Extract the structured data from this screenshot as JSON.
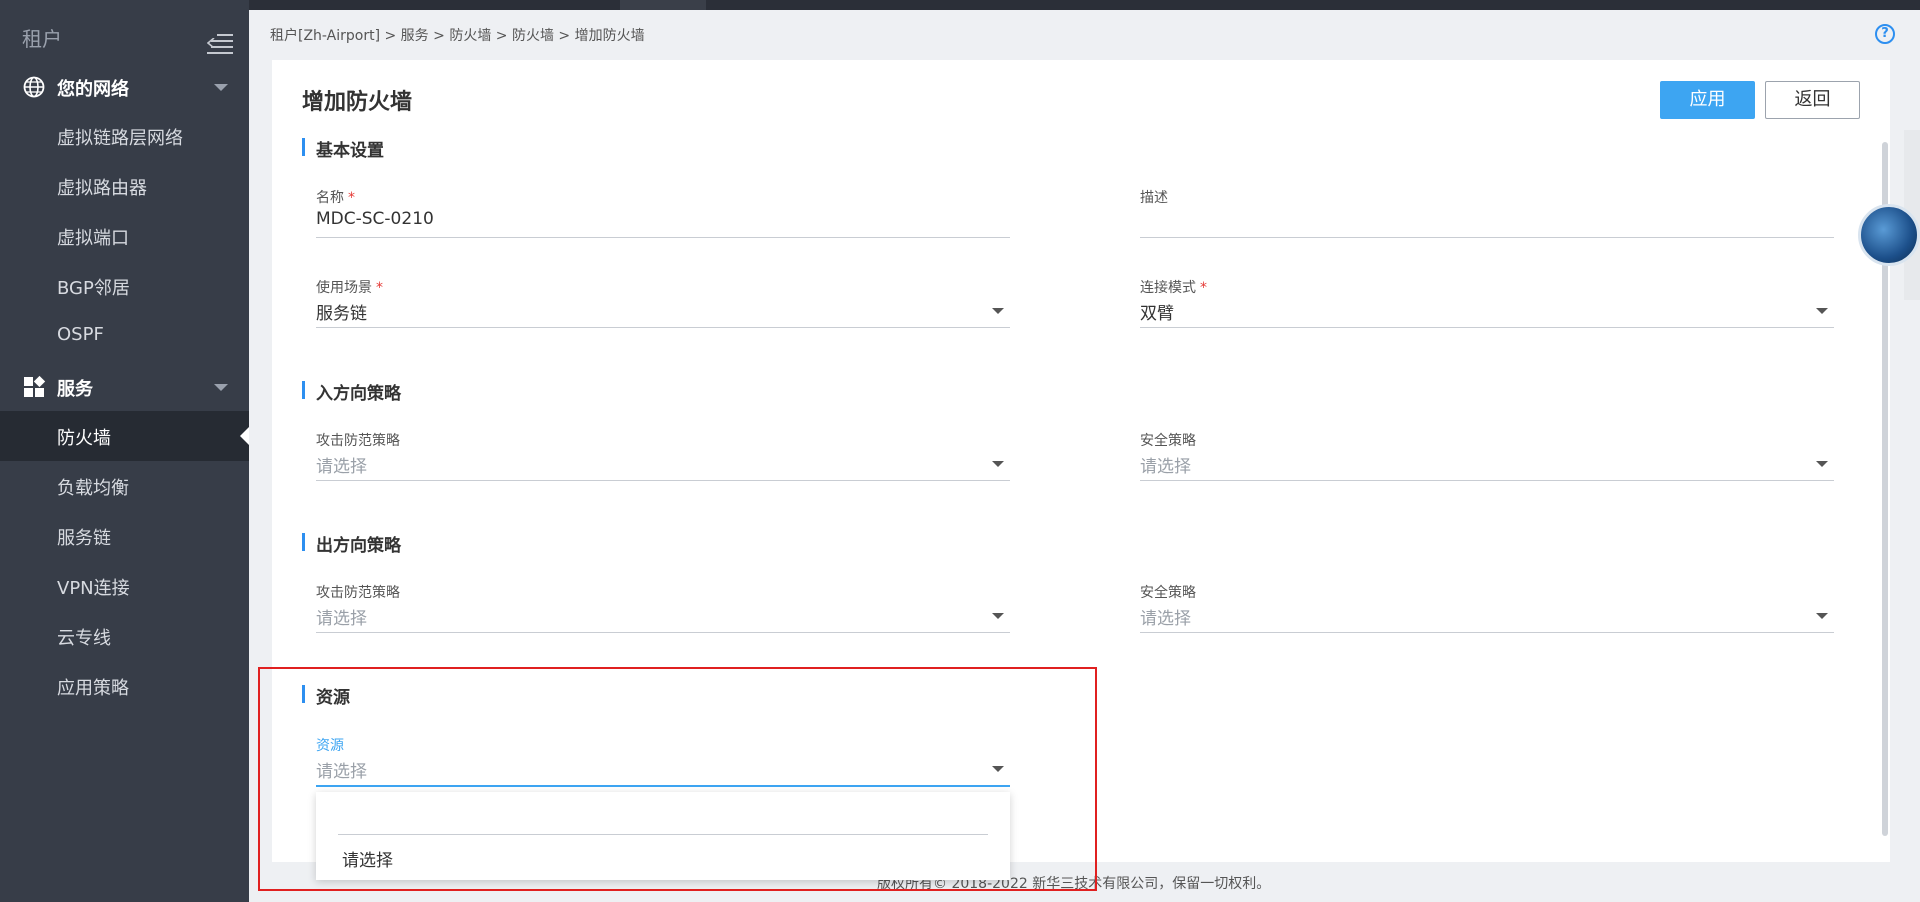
{
  "sidebar": {
    "title": "租户",
    "groups": [
      {
        "label": "您的网络",
        "icon": "globe-icon",
        "items": [
          "虚拟链路层网络",
          "虚拟路由器",
          "虚拟端口",
          "BGP邻居",
          "OSPF"
        ]
      },
      {
        "label": "服务",
        "icon": "grid-icon",
        "items": [
          "防火墙",
          "负载均衡",
          "服务链",
          "VPN连接",
          "云专线",
          "应用策略"
        ]
      }
    ],
    "active_item": "防火墙"
  },
  "breadcrumb": "租户[Zh-Airport] > 服务 > 防火墙 > 防火墙 > 增加防火墙",
  "help_icon_glyph": "?",
  "page": {
    "title": "增加防火墙",
    "buttons": {
      "apply": "应用",
      "back": "返回"
    }
  },
  "sections": {
    "basic": {
      "title": "基本设置",
      "name_label": "名称",
      "name_value": "MDC-SC-0210",
      "desc_label": "描述",
      "desc_value": "",
      "scenario_label": "使用场景",
      "scenario_value": "服务链",
      "mode_label": "连接模式",
      "mode_value": "双臂"
    },
    "inbound": {
      "title": "入方向策略",
      "attack_label": "攻击防范策略",
      "attack_value": "请选择",
      "security_label": "安全策略",
      "security_value": "请选择"
    },
    "outbound": {
      "title": "出方向策略",
      "attack_label": "攻击防范策略",
      "attack_value": "请选择",
      "security_label": "安全策略",
      "security_value": "请选择"
    },
    "resource": {
      "title": "资源",
      "resource_label": "资源",
      "resource_value": "请选择",
      "dropdown_options": [
        "请选择"
      ]
    }
  },
  "required_mark": "*",
  "footer": "版权所有© 2018-2022 新华三技术有限公司，保留一切权利。",
  "colors": {
    "sidebar_bg": "#373d48",
    "sidebar_active": "#262b33",
    "accent": "#3da5f2",
    "required": "#e53935",
    "highlight_box": "#e02020"
  }
}
